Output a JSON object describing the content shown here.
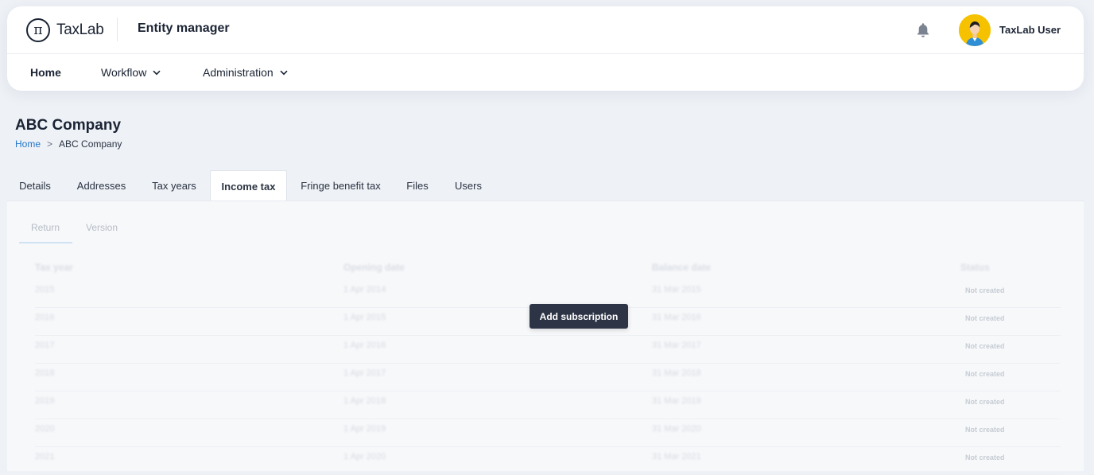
{
  "header": {
    "logo_glyph": "π",
    "logo_text": "TaxLab",
    "app_title": "Entity manager",
    "user_name": "TaxLab User",
    "icons": {
      "notifications": "bell-icon",
      "avatar": "user-avatar"
    }
  },
  "nav": {
    "items": [
      {
        "label": "Home",
        "active": true,
        "dropdown": false
      },
      {
        "label": "Workflow",
        "active": false,
        "dropdown": true
      },
      {
        "label": "Administration",
        "active": false,
        "dropdown": true
      }
    ]
  },
  "page": {
    "title": "ABC Company",
    "breadcrumb": {
      "home": "Home",
      "separator": ">",
      "current": "ABC Company"
    }
  },
  "tabs": [
    {
      "label": "Details",
      "active": false
    },
    {
      "label": "Addresses",
      "active": false
    },
    {
      "label": "Tax years",
      "active": false
    },
    {
      "label": "Income tax",
      "active": true
    },
    {
      "label": "Fringe benefit tax",
      "active": false
    },
    {
      "label": "Files",
      "active": false
    },
    {
      "label": "Users",
      "active": false
    }
  ],
  "subtabs": [
    {
      "label": "Return",
      "active": true
    },
    {
      "label": "Version",
      "active": false
    }
  ],
  "table": {
    "headers": [
      "Tax year",
      "Opening date",
      "Balance date",
      "Status"
    ],
    "rows": [
      [
        "2015",
        "1 Apr 2014",
        "31 Mar 2015",
        "Not created"
      ],
      [
        "2016",
        "1 Apr 2015",
        "31 Mar 2016",
        "Not created"
      ],
      [
        "2017",
        "1 Apr 2016",
        "31 Mar 2017",
        "Not created"
      ],
      [
        "2018",
        "1 Apr 2017",
        "31 Mar 2018",
        "Not created"
      ],
      [
        "2019",
        "1 Apr 2018",
        "31 Mar 2019",
        "Not created"
      ],
      [
        "2020",
        "1 Apr 2019",
        "31 Mar 2020",
        "Not created"
      ],
      [
        "2021",
        "1 Apr 2020",
        "31 Mar 2021",
        "Not created"
      ]
    ]
  },
  "overlay": {
    "button_label": "Add subscription"
  },
  "colors": {
    "accent_link": "#2476c8",
    "button_dark": "#2d3446",
    "page_bg": "#eef1f6"
  }
}
